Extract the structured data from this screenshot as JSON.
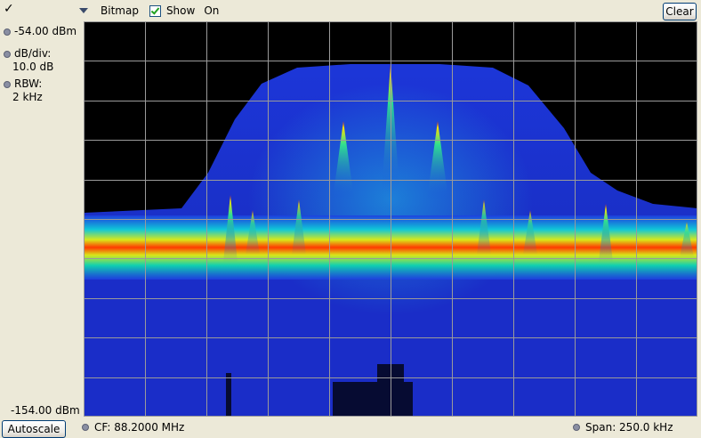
{
  "toolbar": {
    "check_icon": "check-icon",
    "display_label": "Bitmap",
    "show_label": "Show",
    "show_state": "On",
    "clear_label": "Clear"
  },
  "scale": {
    "ref_level": "-54.00 dBm",
    "db_div_label": "dB/div:",
    "db_div_value": "10.0 dB",
    "rbw_label": "RBW:",
    "rbw_value": "2 kHz",
    "bottom_level": "-154.00 dBm",
    "autoscale_label": "Autoscale"
  },
  "footer": {
    "cf": "CF: 88.2000 MHz",
    "span": "Span: 250.0 kHz"
  },
  "colors": {
    "plot_bg": "#000000",
    "grid": "#9a9a9a",
    "spectrum_low": "#1a2fd0",
    "spectrum_mid": "#18e0c0",
    "spectrum_high": "#ffee00",
    "spectrum_peak": "#e00000"
  }
}
